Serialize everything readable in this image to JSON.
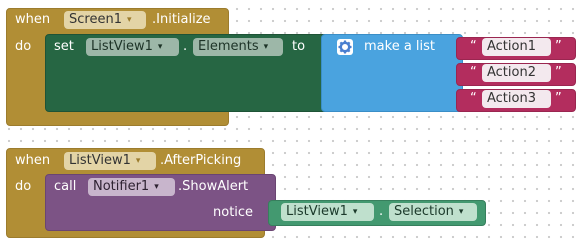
{
  "block1": {
    "when": "when",
    "component": "Screen1",
    "event": ".Initialize",
    "do": "do",
    "set": "set",
    "target_component": "ListView1",
    "dot": ".",
    "property": "Elements",
    "to": "to",
    "make_list": "make a list",
    "items": [
      "Action1",
      "Action2",
      "Action3"
    ]
  },
  "block2": {
    "when": "when",
    "component": "ListView1",
    "event": ".AfterPicking",
    "do": "do",
    "call": "call",
    "callee_component": "Notifier1",
    "method": ".ShowAlert",
    "notice": "notice",
    "getter_component": "ListView1",
    "dot": ".",
    "getter_property": "Selection"
  },
  "quote_open": "“",
  "quote_close": "”",
  "dropdown_arrow": "▾",
  "colors": {
    "control": "#b18e35",
    "component_setter": "#266643",
    "list": "#4aa3df",
    "text": "#b32d5e",
    "procedure": "#7c5385",
    "component_getter": "#439970"
  }
}
